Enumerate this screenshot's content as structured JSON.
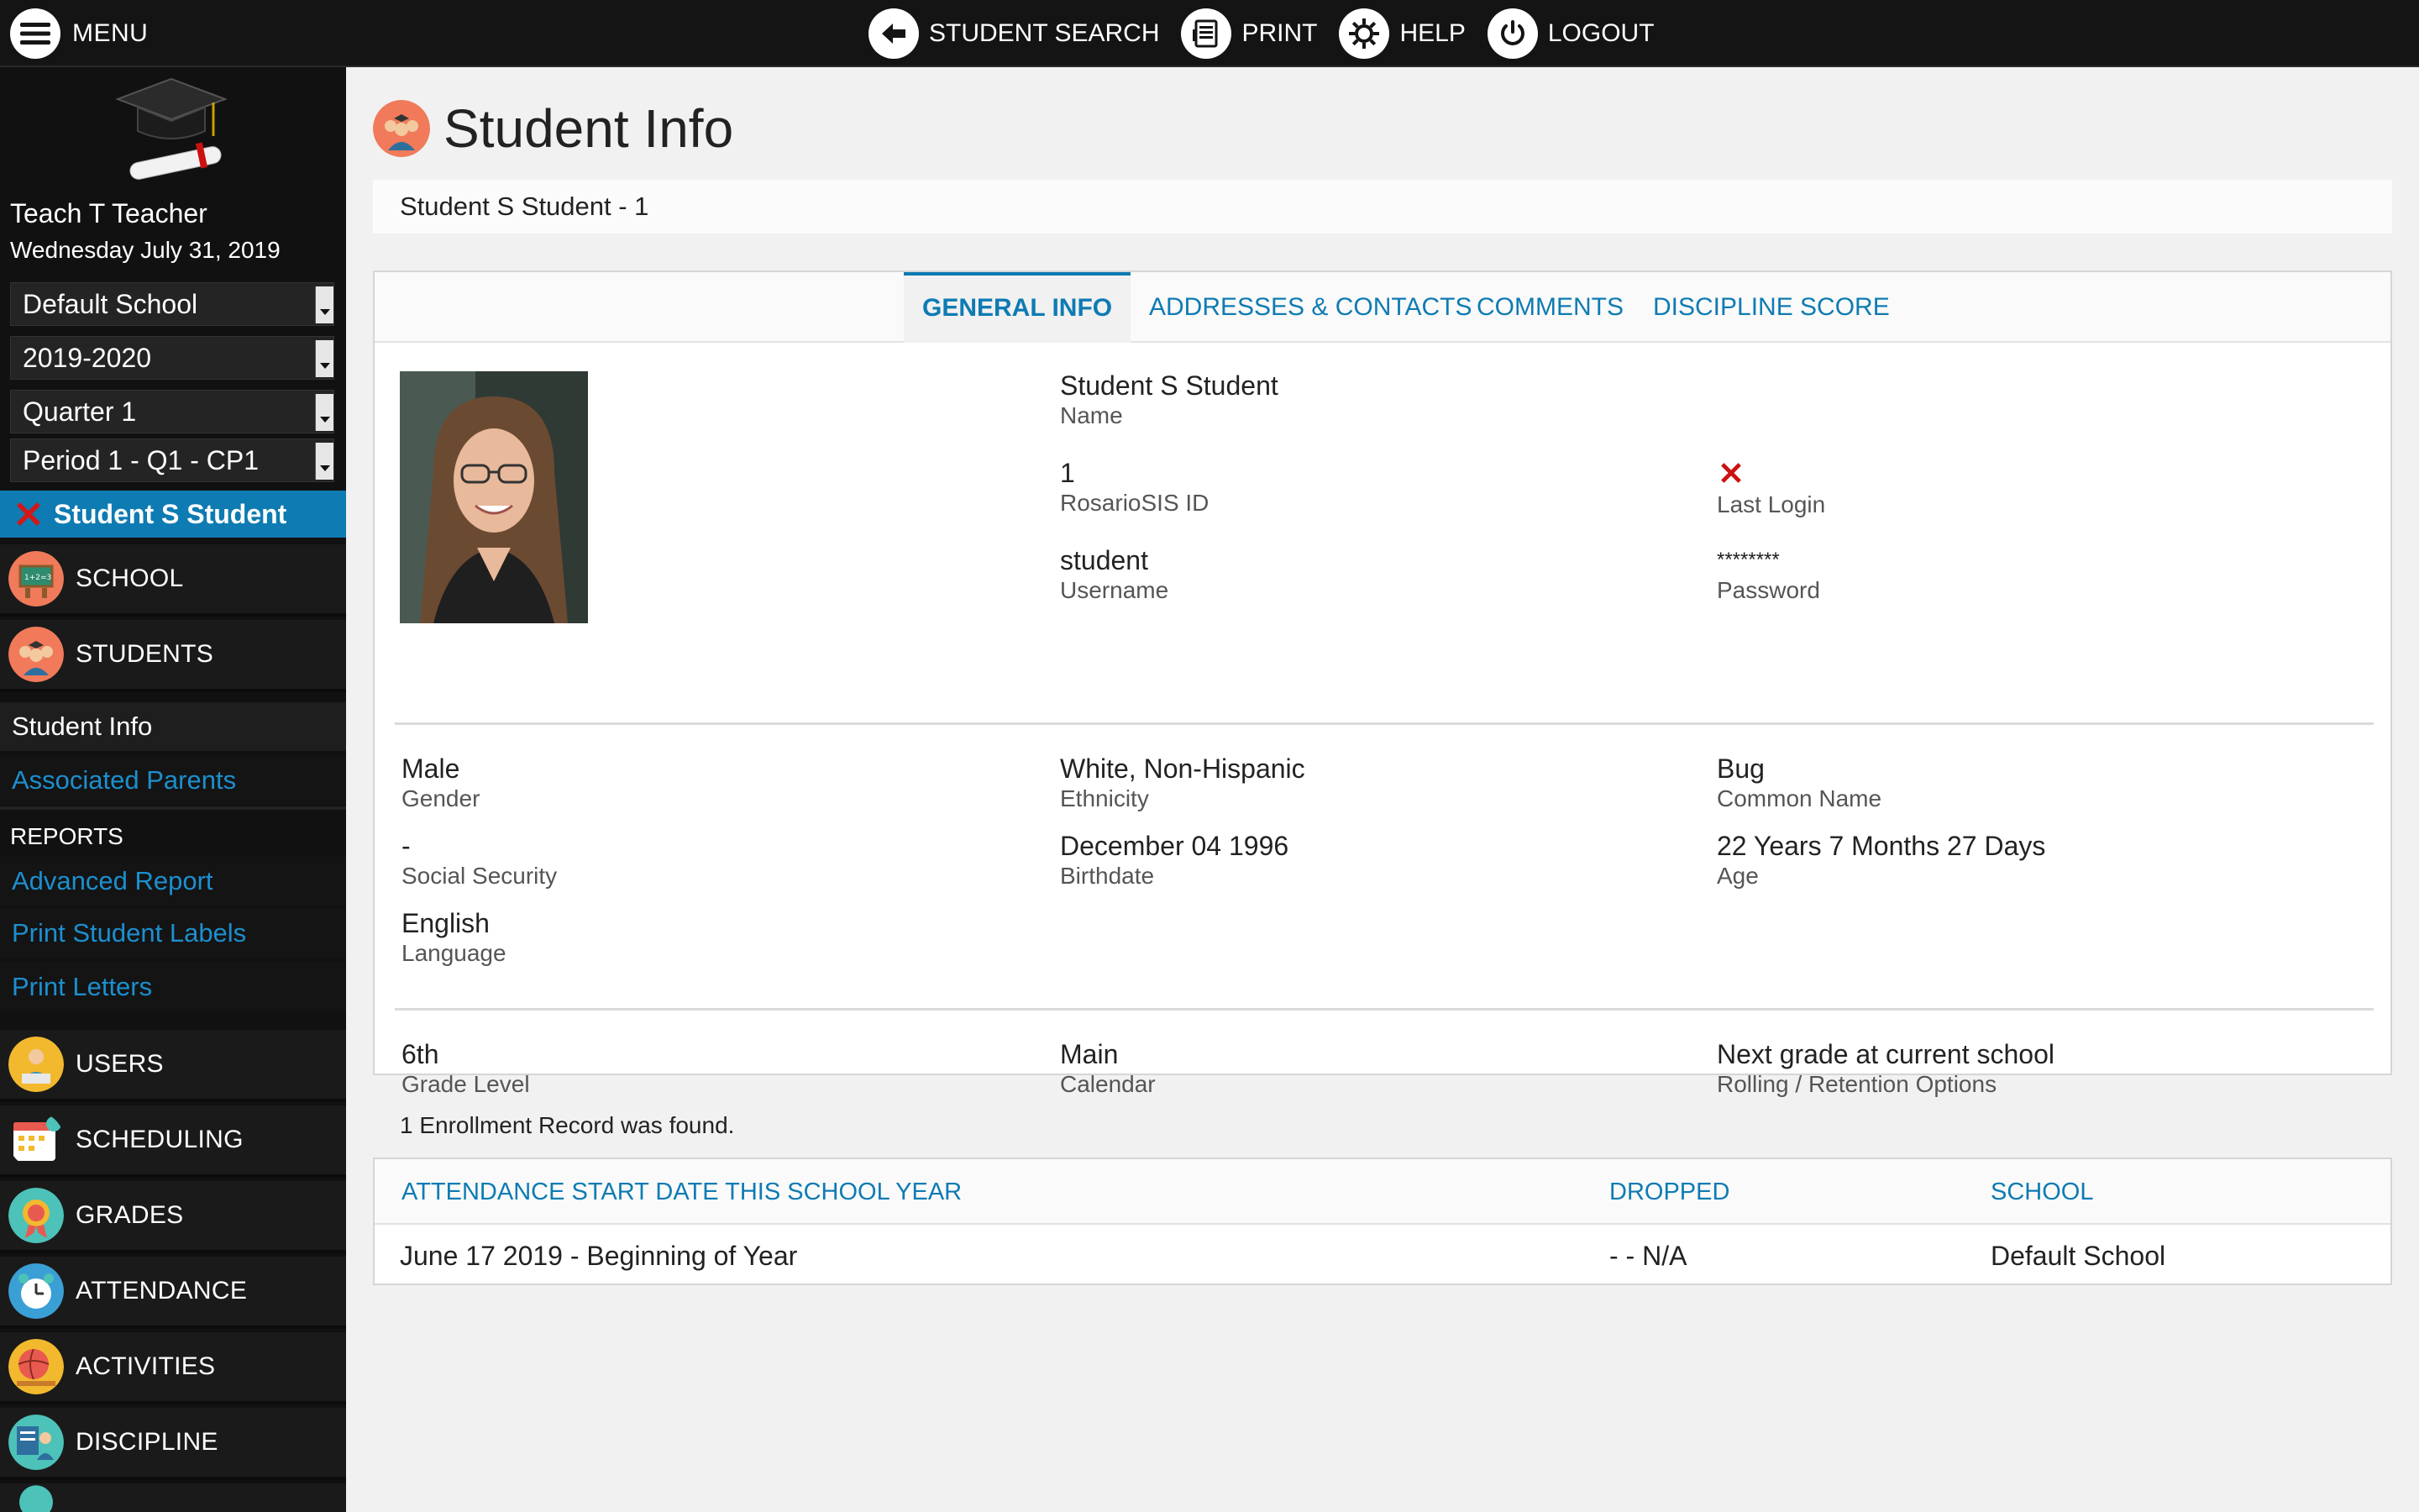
{
  "topbar": {
    "menu_label": "MENU",
    "nav": [
      {
        "label": "STUDENT SEARCH",
        "icon": "back-arrow-icon"
      },
      {
        "label": "PRINT",
        "icon": "print-icon"
      },
      {
        "label": "HELP",
        "icon": "help-gear-icon"
      },
      {
        "label": "LOGOUT",
        "icon": "power-icon"
      }
    ]
  },
  "sidebar": {
    "user_name": "Teach T Teacher",
    "date": "Wednesday July 31, 2019",
    "selects": {
      "school": "Default School",
      "year": "2019-2020",
      "quarter": "Quarter 1",
      "period": "Period 1 - Q1 - CP1"
    },
    "current_student": "Student S Student",
    "menu": {
      "school": "SCHOOL",
      "students": "STUDENTS",
      "student_info": "Student Info",
      "associated_parents": "Associated Parents",
      "reports_header": "REPORTS",
      "advanced_report": "Advanced Report",
      "print_student_labels": "Print Student Labels",
      "print_letters": "Print Letters",
      "users": "USERS",
      "scheduling": "SCHEDULING",
      "grades": "GRADES",
      "attendance": "ATTENDANCE",
      "activities": "ACTIVITIES",
      "discipline": "DISCIPLINE"
    }
  },
  "page": {
    "title": "Student Info",
    "student_bar": "Student S Student - 1"
  },
  "tabs": {
    "general": "GENERAL INFO",
    "addresses": "ADDRESSES & CONTACTS",
    "comments": "COMMENTS",
    "discipline": "DISCIPLINE SCORE"
  },
  "general": {
    "name": {
      "value": "Student S Student",
      "label": "Name"
    },
    "rosario_id": {
      "value": "1",
      "label": "RosarioSIS ID"
    },
    "username": {
      "value": "student",
      "label": "Username"
    },
    "last_login": {
      "label": "Last Login"
    },
    "password": {
      "value": "********",
      "label": "Password"
    },
    "gender": {
      "value": "Male",
      "label": "Gender"
    },
    "ethnicity": {
      "value": "White, Non-Hispanic",
      "label": "Ethnicity"
    },
    "common_name": {
      "value": "Bug",
      "label": "Common Name"
    },
    "social_security": {
      "value": "-",
      "label": "Social Security"
    },
    "birthdate": {
      "value": "December 04 1996",
      "label": "Birthdate"
    },
    "age": {
      "value": "22 Years 7 Months 27 Days",
      "label": "Age"
    },
    "language": {
      "value": "English",
      "label": "Language"
    },
    "grade_level": {
      "value": "6th",
      "label": "Grade Level"
    },
    "calendar": {
      "value": "Main",
      "label": "Calendar"
    },
    "rolling": {
      "value": "Next grade at current school",
      "label": "Rolling / Retention Options"
    }
  },
  "enrollment": {
    "note": "1 Enrollment Record was found.",
    "headers": {
      "start": "ATTENDANCE START DATE THIS SCHOOL YEAR",
      "dropped": "DROPPED",
      "school": "SCHOOL"
    },
    "row": {
      "start": "June 17 2019 - Beginning of Year",
      "dropped": "- - N/A",
      "school": "Default School"
    }
  },
  "colors": {
    "accent": "#0e7bb3",
    "sidebar_bg": "#111111",
    "topbar_bg": "#141414",
    "error_red": "#cc1111"
  }
}
